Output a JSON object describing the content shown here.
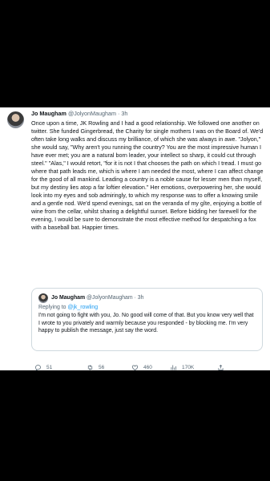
{
  "tweet": {
    "author_name": "Jo Maugham",
    "author_handle": "@JolyonMaugham",
    "separator": "·",
    "time": "3h",
    "text": "Once upon a time, JK Rowling and I had a good relationship. We followed one another on twitter. She funded Gingerbread, the Charity for single mothers I was on the Board of. We'd often take long walks and discuss my brilliance, of which she was always in awe. \"Jolyon,\" she would say, \"Why aren't you running the country? You are the most impressive human I have ever met; you are a natural born leader, your intellect so sharp, it could cut through steel.\" \"Alas,\" I would retort, \"for it is not I that chooses the path on which I tread. I must go where that path leads me, which is where I am needed the most, where I can affect change for the good of all mankind. Leading a country is a noble cause for lesser men than myself, but my destiny lies atop a far loftier elevation.\" Her emotions, overpowering her, she would look into my eyes and sob admiringly, to which my response was to offer a knowing smile and a gentle nod. We'd spend evenings, sat on the veranda of my gîte, enjoying a bottle of wine from the cellar, whilst sharing a delightful sunset. Before bidding her farewell for the evening, I would be sure to demonstrate the most effective method for despatching a fox with a baseball bat. Happier times."
  },
  "quoted": {
    "author_name": "Jo Maugham",
    "author_handle": "@JolyonMaugham",
    "separator": "·",
    "time": "3h",
    "replying_prefix": "Replying to",
    "replying_handle": "@jk_rowling",
    "text": "I'm not going to fight with you, Jo. No good will come of that. But you know very well that I wrote to you privately and warmly because you responded - by blocking me. I'm very happy to publish the message, just say the word."
  },
  "actions": {
    "replies": "51",
    "retweets": "56",
    "likes": "460",
    "views": "170K",
    "icons": [
      "reply-icon",
      "retweet-icon",
      "like-icon",
      "views-icon",
      "share-icon"
    ]
  }
}
